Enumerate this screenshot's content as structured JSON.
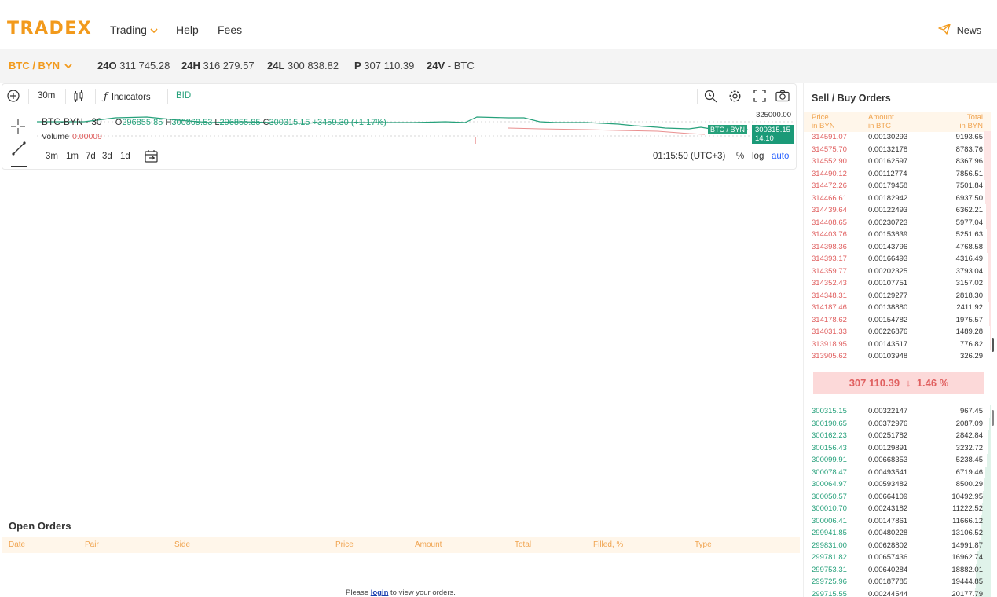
{
  "brand": {
    "logo": "TRADEX"
  },
  "nav": {
    "trading": "Trading",
    "help": "Help",
    "fees": "Fees",
    "news": "News"
  },
  "ticker": {
    "pair": "BTC / BYN",
    "open_label": "24O",
    "open_value": "311 745.28",
    "high_label": "24H",
    "high_value": "316 279.57",
    "low_label": "24L",
    "low_value": "300 838.82",
    "price_label": "P",
    "price_value": "307 110.39",
    "volume_label": "24V",
    "volume_value": "- BTC"
  },
  "chart_toolbar": {
    "interval": "30m",
    "indicators": "Indicators",
    "bid": "BID"
  },
  "chart": {
    "pair_name": "BTC-BYN · 30",
    "o_label": "O",
    "o_value": "296855.85",
    "h_label": "H",
    "h_value": "300869.53",
    "l_label": "L",
    "l_value": "296855.85",
    "c_label": "C",
    "c_value": "300315.15",
    "change": "+3459.30 (+1.17%)",
    "volume_label": "Volume",
    "volume_value": "0.00009",
    "top_price": "325000.00",
    "pair_badge": "BTC / BYN",
    "price_badge": "300315.15",
    "price_badge_time": "14:10",
    "accent_up": "#26a17b",
    "accent_down": "#e06060"
  },
  "chart_bottom": {
    "tf_3m": "3m",
    "tf_1m": "1m",
    "tf_7d": "7d",
    "tf_3d": "3d",
    "tf_1d": "1d",
    "time": "01:15:50 (UTC+3)",
    "pct": "%",
    "log": "log",
    "auto": "auto"
  },
  "open_orders": {
    "title": "Open Orders",
    "columns": [
      "Date",
      "Pair",
      "Side",
      "Price",
      "Amount",
      "Total",
      "Filled, %",
      "Type"
    ],
    "msg_before": "Please ",
    "login": "login",
    "msg_after": " to view your orders."
  },
  "orderbook": {
    "title": "Sell / Buy Orders",
    "col_price": "Price",
    "col_price_unit": "in BYN",
    "col_amount": "Amount",
    "col_amount_unit": "in BTC",
    "col_total": "Total",
    "col_total_unit": "in BYN",
    "mid_price": "307 110.39",
    "mid_arrow": "↓",
    "mid_change": "1.46 %",
    "sells": [
      {
        "price": "314591.07",
        "amount": "0.00130293",
        "total": "9193.65",
        "depth": 0.46
      },
      {
        "price": "314575.70",
        "amount": "0.00132178",
        "total": "8783.76",
        "depth": 0.44
      },
      {
        "price": "314552.90",
        "amount": "0.00162597",
        "total": "8367.96",
        "depth": 0.42
      },
      {
        "price": "314490.12",
        "amount": "0.00112774",
        "total": "7856.51",
        "depth": 0.39
      },
      {
        "price": "314472.26",
        "amount": "0.00179458",
        "total": "7501.84",
        "depth": 0.37
      },
      {
        "price": "314466.61",
        "amount": "0.00182942",
        "total": "6937.50",
        "depth": 0.35
      },
      {
        "price": "314439.64",
        "amount": "0.00122493",
        "total": "6362.21",
        "depth": 0.32
      },
      {
        "price": "314408.65",
        "amount": "0.00230723",
        "total": "5977.04",
        "depth": 0.3
      },
      {
        "price": "314403.76",
        "amount": "0.00153639",
        "total": "5251.63",
        "depth": 0.26
      },
      {
        "price": "314398.36",
        "amount": "0.00143796",
        "total": "4768.58",
        "depth": 0.24
      },
      {
        "price": "314393.17",
        "amount": "0.00166493",
        "total": "4316.49",
        "depth": 0.22
      },
      {
        "price": "314359.77",
        "amount": "0.00202325",
        "total": "3793.04",
        "depth": 0.19
      },
      {
        "price": "314352.43",
        "amount": "0.00107751",
        "total": "3157.02",
        "depth": 0.16
      },
      {
        "price": "314348.31",
        "amount": "0.00129277",
        "total": "2818.30",
        "depth": 0.14
      },
      {
        "price": "314187.46",
        "amount": "0.00138880",
        "total": "2411.92",
        "depth": 0.12
      },
      {
        "price": "314178.62",
        "amount": "0.00154782",
        "total": "1975.57",
        "depth": 0.1
      },
      {
        "price": "314031.33",
        "amount": "0.00226876",
        "total": "1489.28",
        "depth": 0.07
      },
      {
        "price": "313918.95",
        "amount": "0.00143517",
        "total": "776.82",
        "depth": 0.04
      },
      {
        "price": "313905.62",
        "amount": "0.00103948",
        "total": "326.29",
        "depth": 0.02
      }
    ],
    "buys": [
      {
        "price": "300315.15",
        "amount": "0.00322147",
        "total": "967.45",
        "depth": 0.05
      },
      {
        "price": "300190.65",
        "amount": "0.00372976",
        "total": "2087.09",
        "depth": 0.1
      },
      {
        "price": "300162.23",
        "amount": "0.00251782",
        "total": "2842.84",
        "depth": 0.14
      },
      {
        "price": "300156.43",
        "amount": "0.00129891",
        "total": "3232.72",
        "depth": 0.16
      },
      {
        "price": "300099.91",
        "amount": "0.00668353",
        "total": "5238.45",
        "depth": 0.26
      },
      {
        "price": "300078.47",
        "amount": "0.00493541",
        "total": "6719.46",
        "depth": 0.33
      },
      {
        "price": "300064.97",
        "amount": "0.00593482",
        "total": "8500.29",
        "depth": 0.42
      },
      {
        "price": "300050.57",
        "amount": "0.00664109",
        "total": "10492.95",
        "depth": 0.52
      },
      {
        "price": "300010.70",
        "amount": "0.00243182",
        "total": "11222.52",
        "depth": 0.56
      },
      {
        "price": "300006.41",
        "amount": "0.00147861",
        "total": "11666.12",
        "depth": 0.58
      },
      {
        "price": "299941.85",
        "amount": "0.00480228",
        "total": "13106.52",
        "depth": 0.65
      },
      {
        "price": "299831.00",
        "amount": "0.00628802",
        "total": "14991.87",
        "depth": 0.74
      },
      {
        "price": "299781.82",
        "amount": "0.00657436",
        "total": "16962.74",
        "depth": 0.84
      },
      {
        "price": "299753.31",
        "amount": "0.00640284",
        "total": "18882.01",
        "depth": 0.93
      },
      {
        "price": "299725.96",
        "amount": "0.00187785",
        "total": "19444.85",
        "depth": 0.96
      },
      {
        "price": "299715.55",
        "amount": "0.00244544",
        "total": "20177.79",
        "depth": 1.0
      }
    ]
  }
}
